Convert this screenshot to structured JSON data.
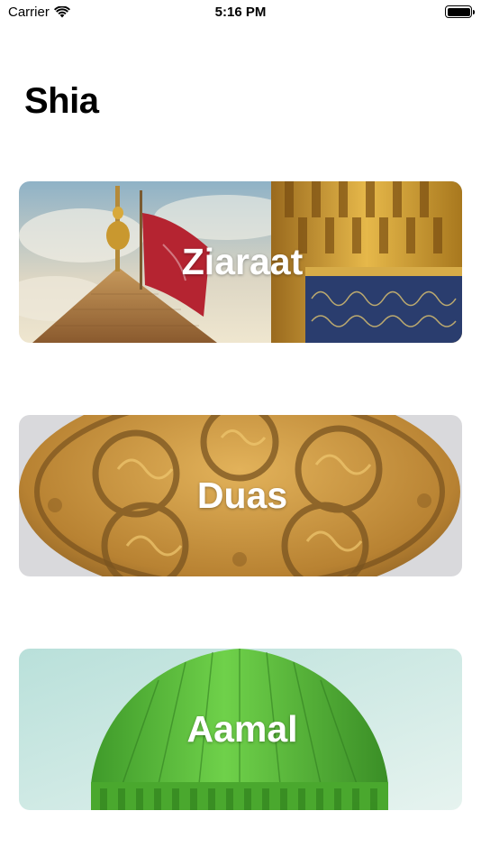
{
  "status_bar": {
    "carrier": "Carrier",
    "time": "5:16 PM",
    "wifi_icon": "wifi-icon",
    "battery_icon": "battery-full-icon"
  },
  "page": {
    "title": "Shia"
  },
  "cards": [
    {
      "label": "Ziaraat",
      "image": "shrine-dome-flag-minaret"
    },
    {
      "label": "Duas",
      "image": "carved-wooden-calligraphy-medallion"
    },
    {
      "label": "Aamal",
      "image": "green-dome"
    }
  ]
}
